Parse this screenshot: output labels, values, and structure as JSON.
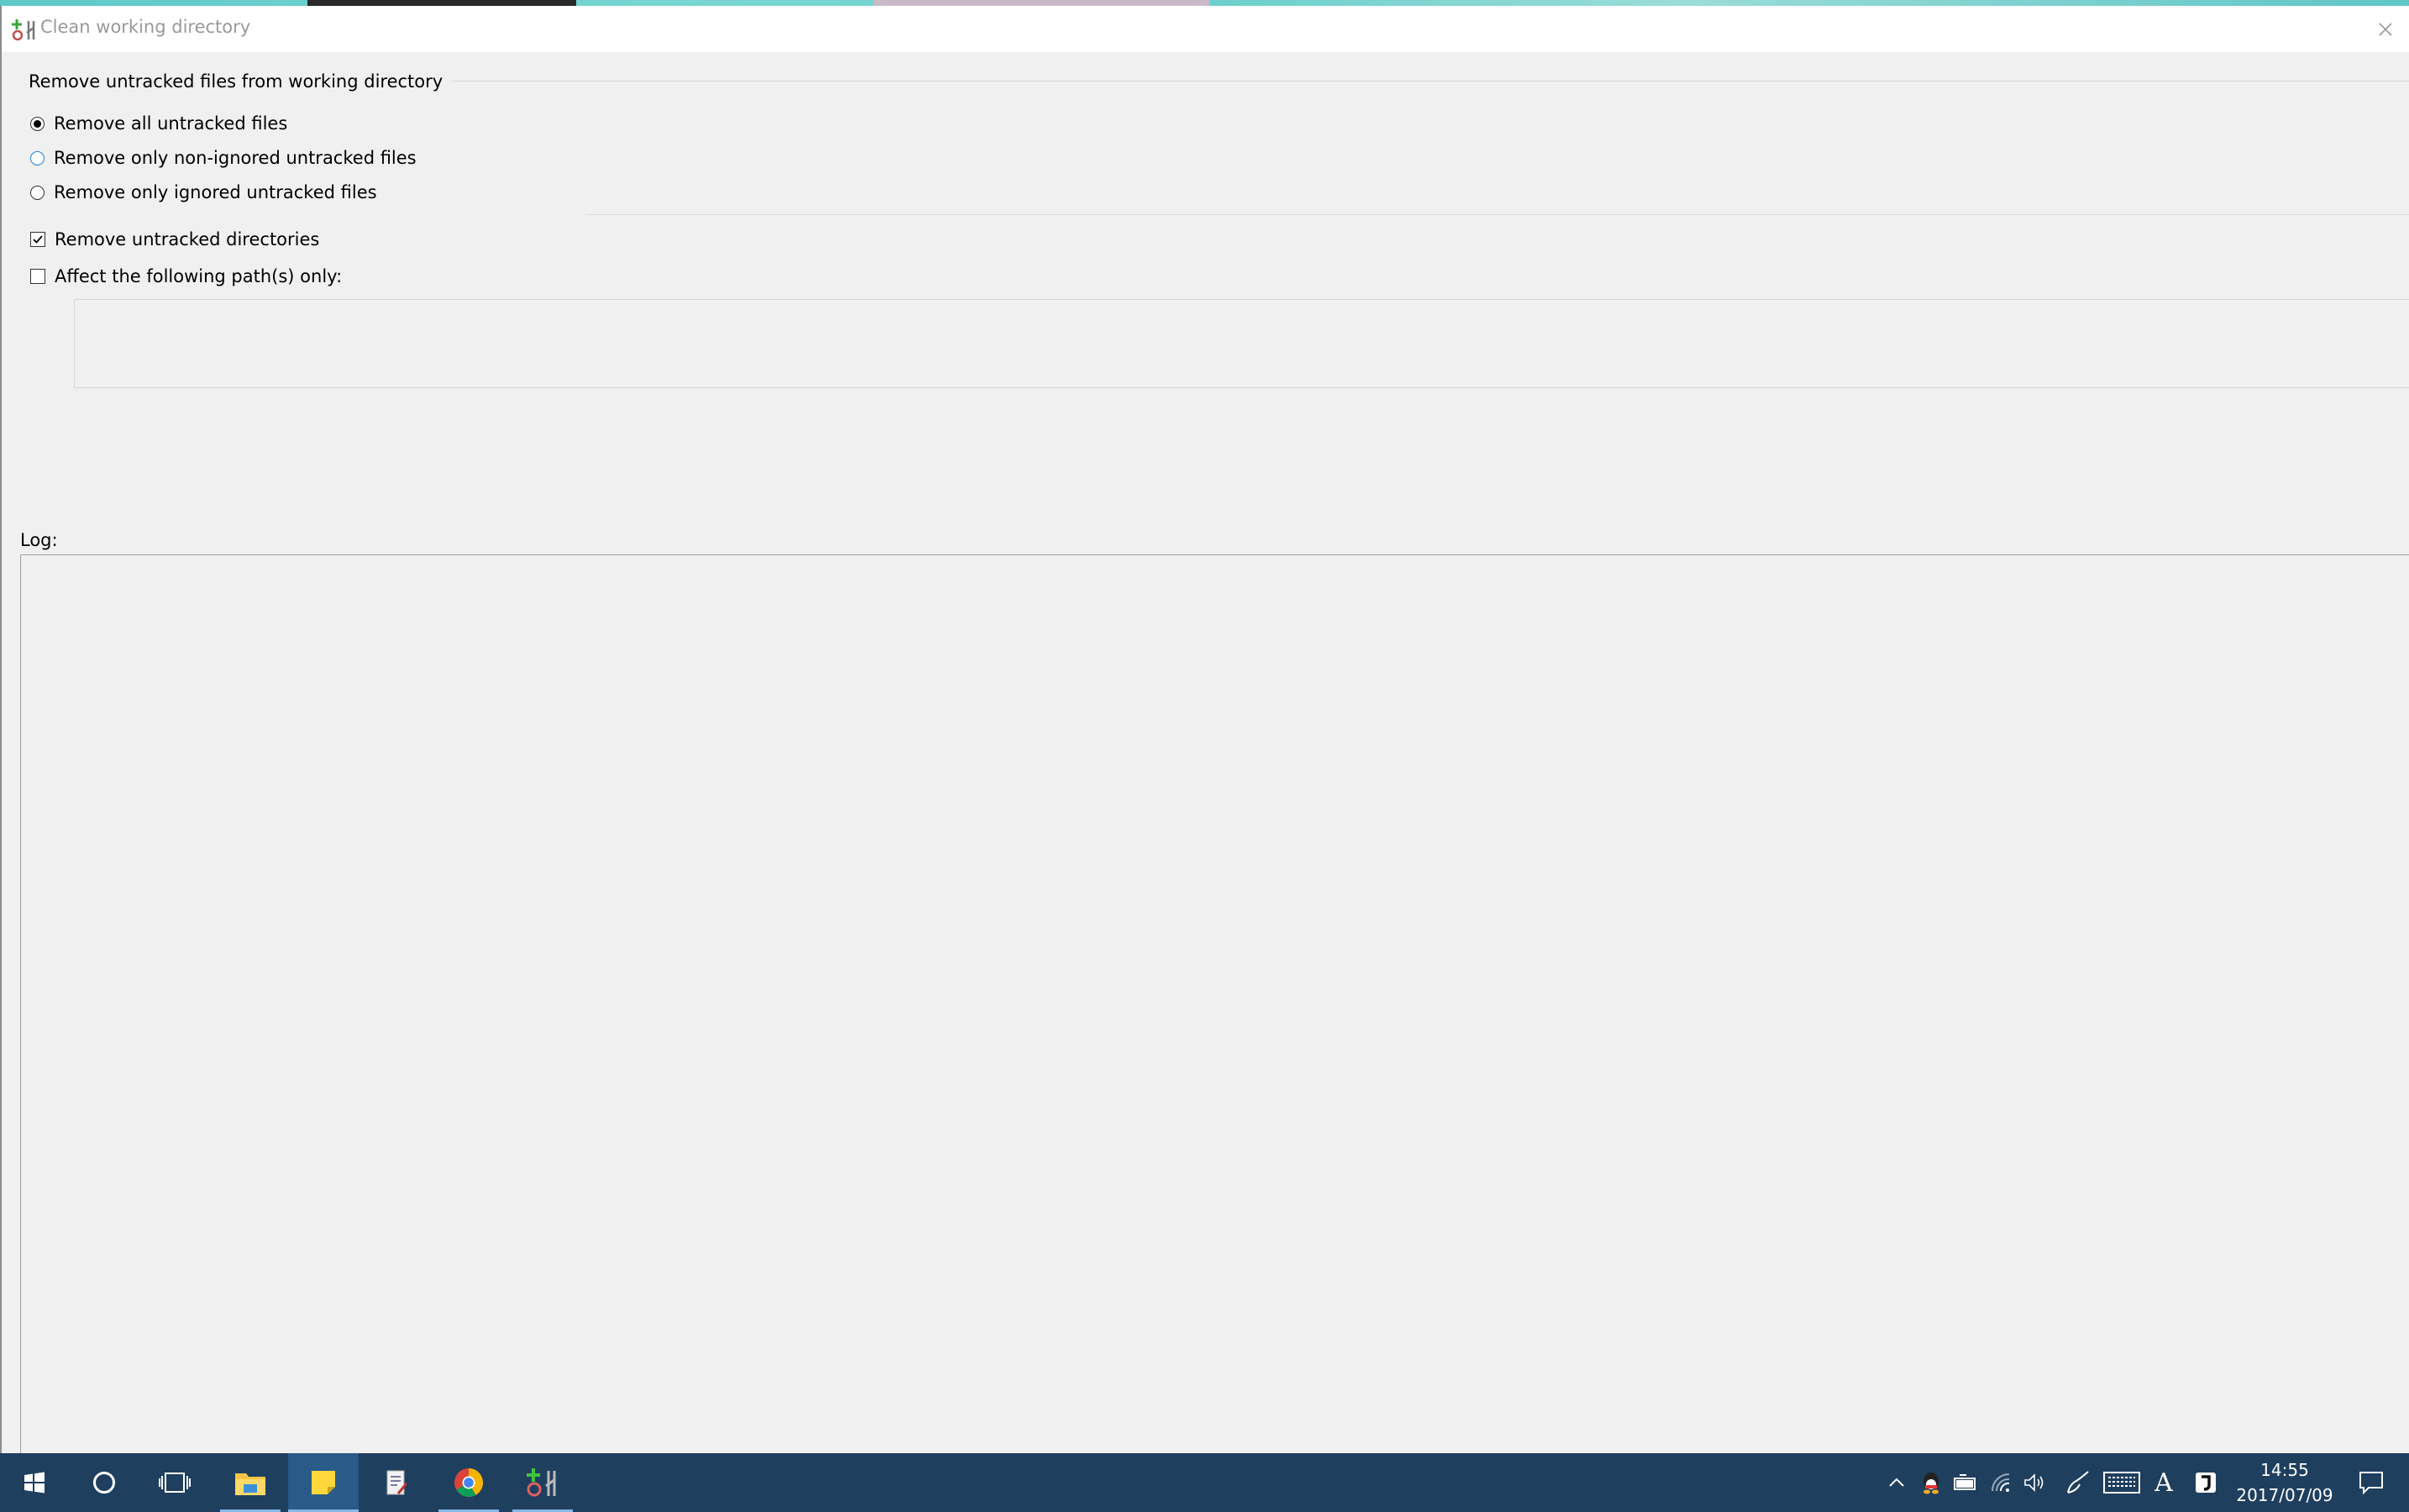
{
  "window": {
    "title": "Clean working directory",
    "close_glyph": "✕"
  },
  "group": {
    "label": "Remove untracked files from working directory",
    "options": [
      {
        "label": "Remove all untracked files",
        "selected": true
      },
      {
        "label": "Remove only non-ignored untracked files",
        "selected": false
      },
      {
        "label": "Remove only ignored untracked files",
        "selected": false
      }
    ]
  },
  "checkboxes": {
    "remove_dirs": {
      "label": "Remove untracked directories",
      "checked": true
    },
    "affect_paths": {
      "label": "Affect the following path(s) only:",
      "checked": false
    }
  },
  "paths_value": "",
  "log": {
    "label": "Log:",
    "content": ""
  },
  "taskbar": {
    "apps": [
      "start-icon",
      "cortana-icon",
      "task-view-icon",
      "file-explorer-icon",
      "sticky-notes-icon",
      "document-icon",
      "chrome-icon",
      "git-extensions-icon"
    ],
    "tray_icons": [
      "chevron-up-icon",
      "qq-icon",
      "battery-icon",
      "wifi-icon",
      "volume-icon",
      "pen-icon",
      "keyboard-icon",
      "ime-icon",
      "app-tray-icon",
      "notification-icon"
    ],
    "ime_text": "A",
    "time": "14:55",
    "date": "2017/07/09"
  },
  "colors": {
    "taskbar": "#1f3f5f",
    "taskbar_active": "#2a5a88",
    "window_bg": "#f0f0f0"
  }
}
